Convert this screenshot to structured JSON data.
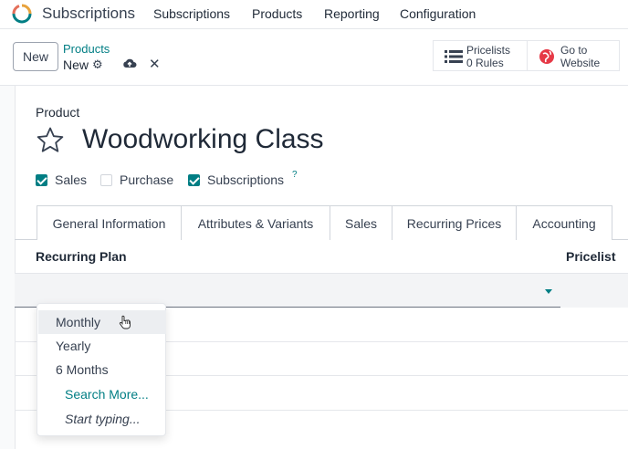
{
  "app": {
    "name": "Subscriptions",
    "brand_color": "#017e84"
  },
  "menu": {
    "items": [
      "Subscriptions",
      "Products",
      "Reporting",
      "Configuration"
    ]
  },
  "control": {
    "new_label": "New",
    "breadcrumb_parent": "Products",
    "breadcrumb_current": "New",
    "icons": [
      "gear-icon",
      "cloud-upload-icon",
      "close-icon"
    ]
  },
  "smart_buttons": [
    {
      "label": "Pricelists",
      "value": "0 Rules",
      "icon": "list-icon"
    },
    {
      "label": "Go to",
      "value": "Website",
      "icon": "globe-icon"
    }
  ],
  "form": {
    "label": "Product",
    "name": "Woodworking Class",
    "checkboxes": [
      {
        "label": "Sales",
        "checked": true
      },
      {
        "label": "Purchase",
        "checked": false
      },
      {
        "label": "Subscriptions",
        "checked": true,
        "help": "?"
      }
    ]
  },
  "tabs": [
    {
      "label": "General Information",
      "active": false
    },
    {
      "label": "Attributes & Variants",
      "active": false
    },
    {
      "label": "Sales",
      "active": false
    },
    {
      "label": "Recurring Prices",
      "active": true
    },
    {
      "label": "Accounting",
      "active": false
    }
  ],
  "table": {
    "headers": [
      "Recurring Plan",
      "Pricelist"
    ]
  },
  "dropdown": {
    "options": [
      "Monthly",
      "Yearly",
      "6 Months"
    ],
    "hovered": "Monthly",
    "search_more": "Search More...",
    "hint": "Start typing..."
  }
}
